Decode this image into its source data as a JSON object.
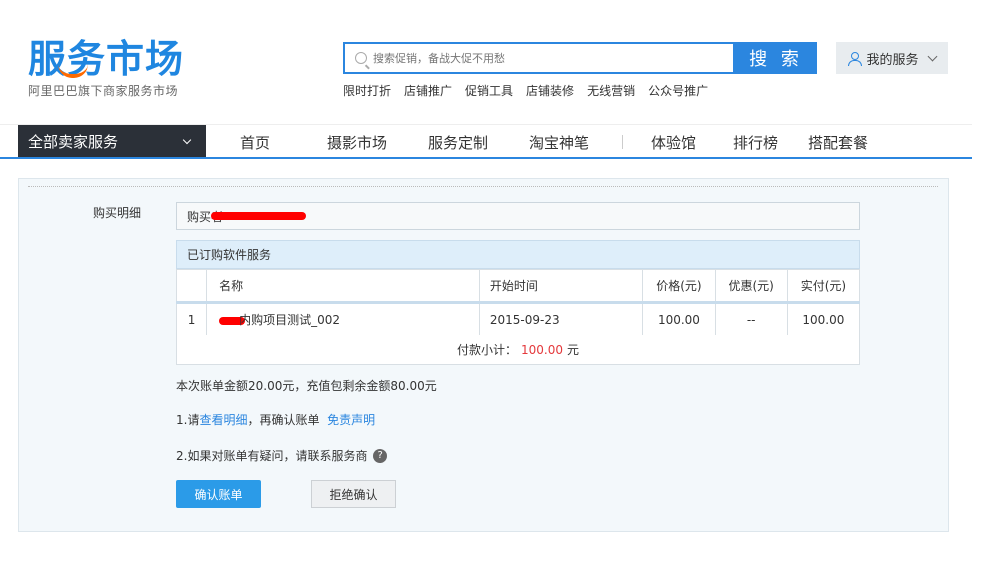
{
  "header": {
    "logo_text": "服务市场",
    "logo_sub": "阿里巴巴旗下商家服务市场",
    "search_placeholder": "搜索促销，备战大促不用愁",
    "search_button": "搜 索",
    "my_service": "我的服务",
    "quick_links": [
      "限时打折",
      "店铺推广",
      "促销工具",
      "店铺装修",
      "无线营销",
      "公众号推广"
    ]
  },
  "nav": {
    "all_services": "全部卖家服务",
    "items": [
      "首页",
      "摄影市场",
      "服务定制",
      "淘宝神笔",
      "体验馆",
      "排行榜",
      "搭配套餐"
    ]
  },
  "main": {
    "purchase_label": "购买明细",
    "buyer_prefix": "购买者",
    "ordered_header": "已订购软件服务",
    "columns": [
      "名称",
      "开始时间",
      "价格(元)",
      "优惠(元)",
      "实付(元)"
    ],
    "rows": [
      {
        "index": "1",
        "name": "内购项目测试_002",
        "start": "2015-09-23",
        "price": "100.00",
        "discount": "--",
        "paid": "100.00"
      }
    ],
    "subtotal_label": "付款小计：",
    "subtotal_amount": "100.00",
    "subtotal_unit": "元",
    "bill_info": "本次账单金额20.00元，充值包剩余金额80.00元",
    "step1_prefix": "1.请",
    "step1_link1": "查看明细",
    "step1_mid": "，再确认账单",
    "step1_link2": "免责声明",
    "step2_text": "2.如果对账单有疑问，请联系服务商",
    "confirm_button": "确认账单",
    "reject_button": "拒绝确认"
  }
}
